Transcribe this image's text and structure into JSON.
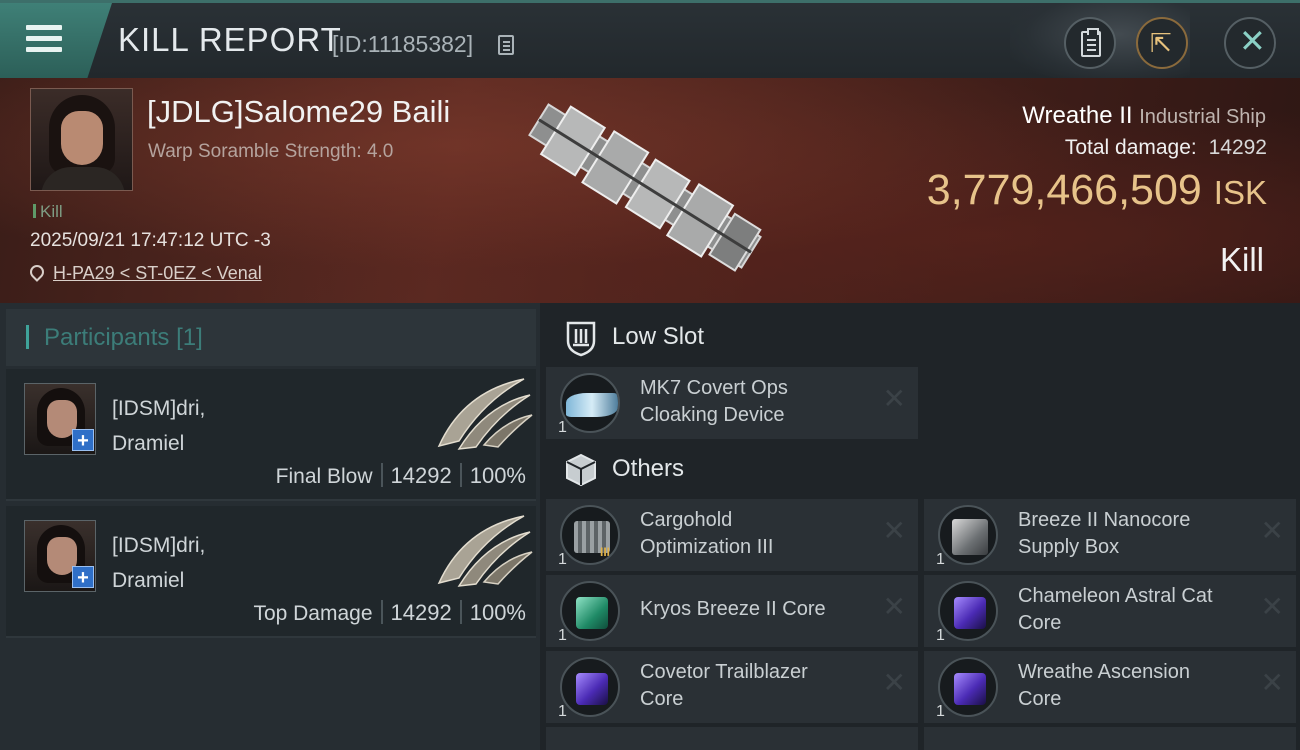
{
  "header": {
    "title": "KILL REPORT",
    "report_id": "[ID:11185382]"
  },
  "victim": {
    "name": "[JDLG]Salome29 Baili",
    "warp_scramble": "Warp Soramble Strength: 4.0",
    "kill_tag": "Kill",
    "datetime": "2025/09/21 17:47:12 UTC -3",
    "location": "H-PA29 < ST-0EZ < Venal"
  },
  "ship": {
    "name": "Wreathe II",
    "class": "Industrial Ship",
    "total_damage_label": "Total damage:",
    "total_damage": "14292",
    "isk_value": "3,779,466,509",
    "isk_unit": "ISK",
    "result": "Kill"
  },
  "participants": {
    "title": "Participants",
    "count": "[1]",
    "rows": [
      {
        "name_line1": "[IDSM]dri,",
        "name_line2": "Dramiel",
        "role": "Final Blow",
        "damage": "14292",
        "percent": "100%"
      },
      {
        "name_line1": "[IDSM]dri,",
        "name_line2": "Dramiel",
        "role": "Top Damage",
        "damage": "14292",
        "percent": "100%"
      }
    ]
  },
  "sections": {
    "low_slot": {
      "title": "Low Slot",
      "items": [
        {
          "line1": "MK7 Covert Ops",
          "line2": "Cloaking Device",
          "qty": "1"
        }
      ]
    },
    "others": {
      "title": "Others",
      "items": [
        {
          "line1": "Cargohold",
          "line2": "Optimization III",
          "qty": "1",
          "roman": "III"
        },
        {
          "line1": "Breeze II Nanocore",
          "line2": "Supply Box",
          "qty": "1"
        },
        {
          "line1": "Kryos Breeze II Core",
          "line2": "",
          "qty": "1"
        },
        {
          "line1": "Chameleon Astral Cat",
          "line2": "Core",
          "qty": "1"
        },
        {
          "line1": "Covetor Trailblazer",
          "line2": "Core",
          "qty": "1"
        },
        {
          "line1": "Wreathe Ascension",
          "line2": "Core",
          "qty": "1"
        }
      ]
    }
  },
  "icons": {
    "menu": "hamburger-icon",
    "copy": "copy-icon",
    "report": "clipboard-icon",
    "share": "share-icon",
    "close": "close-icon",
    "location": "location-pin-icon",
    "low_slot": "low-slot-icon",
    "others": "cube-icon",
    "remove": "x-icon"
  },
  "colors": {
    "accent": "#3fa39a",
    "isk": "#e7c38a",
    "header_bg": "#2a3136",
    "hero_bg": "#4a221c"
  }
}
